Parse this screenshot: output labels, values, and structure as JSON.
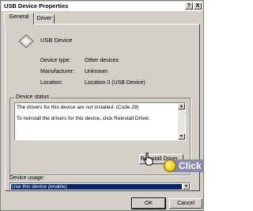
{
  "window": {
    "title": "USB Device Properties",
    "help_button": "?",
    "close_button": "X"
  },
  "tabs": [
    {
      "label": "General",
      "active": true
    },
    {
      "label": "Driver",
      "active": false
    }
  ],
  "device": {
    "name": "USB Device",
    "properties": [
      {
        "label": "Device type:",
        "value": "Other devices"
      },
      {
        "label": "Manufacturer:",
        "value": "Unknown"
      },
      {
        "label": "Location:",
        "value": "Location 0 (USB Device)"
      }
    ]
  },
  "device_status": {
    "title": "Device status",
    "lines": [
      "The drivers for this device are not installed. (Code 28)",
      "To reinstall the drivers for this device, click Reinstall Driver."
    ],
    "reinstall_button": "Reinstall Driver..."
  },
  "device_usage": {
    "label": "Device usage:",
    "selected": "Use this device (enable)"
  },
  "footer": {
    "ok_button": "OK",
    "cancel_button": "Cancel"
  },
  "overlay": {
    "click_label": "Click"
  },
  "icons": {
    "device": "usb-device-icon",
    "pointer": "hand-cursor-icon"
  }
}
